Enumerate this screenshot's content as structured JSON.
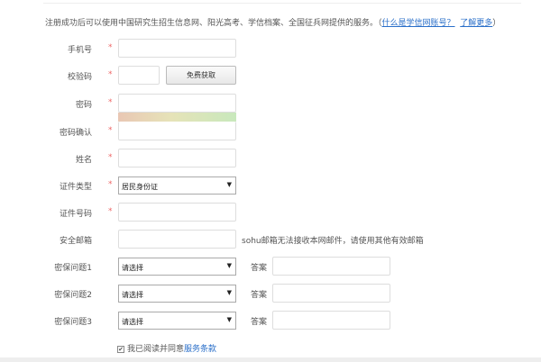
{
  "intro": {
    "text": "注册成功后可以使用中国研究生招生信息网、阳光高考、学信档案、全国征兵网提供的服务。（",
    "link1": "什么是学信网账号？",
    "link2": "了解更多",
    "close": "）"
  },
  "required_mark": "*",
  "fields": {
    "phone": {
      "label": "手机号",
      "value": ""
    },
    "code": {
      "label": "校验码",
      "value": "",
      "button": "免费获取"
    },
    "password": {
      "label": "密码",
      "value": "",
      "strength": "weak-to-strong gradient"
    },
    "password_confirm": {
      "label": "密码确认",
      "value": ""
    },
    "name": {
      "label": "姓名",
      "value": ""
    },
    "id_type": {
      "label": "证件类型",
      "selected": "居民身份证"
    },
    "id_number": {
      "label": "证件号码",
      "value": ""
    },
    "email": {
      "label": "安全邮箱",
      "value": "",
      "hint": "sohu邮箱无法接收本网邮件，请使用其他有效邮箱"
    }
  },
  "security_questions": [
    {
      "label": "密保问题1",
      "selected": "请选择",
      "answer_label": "答案",
      "answer": ""
    },
    {
      "label": "密保问题2",
      "selected": "请选择",
      "answer_label": "答案",
      "answer": ""
    },
    {
      "label": "密保问题3",
      "selected": "请选择",
      "answer_label": "答案",
      "answer": ""
    }
  ],
  "agree": {
    "checked": true,
    "text": "我已阅读并同意",
    "link": "服务条款"
  }
}
